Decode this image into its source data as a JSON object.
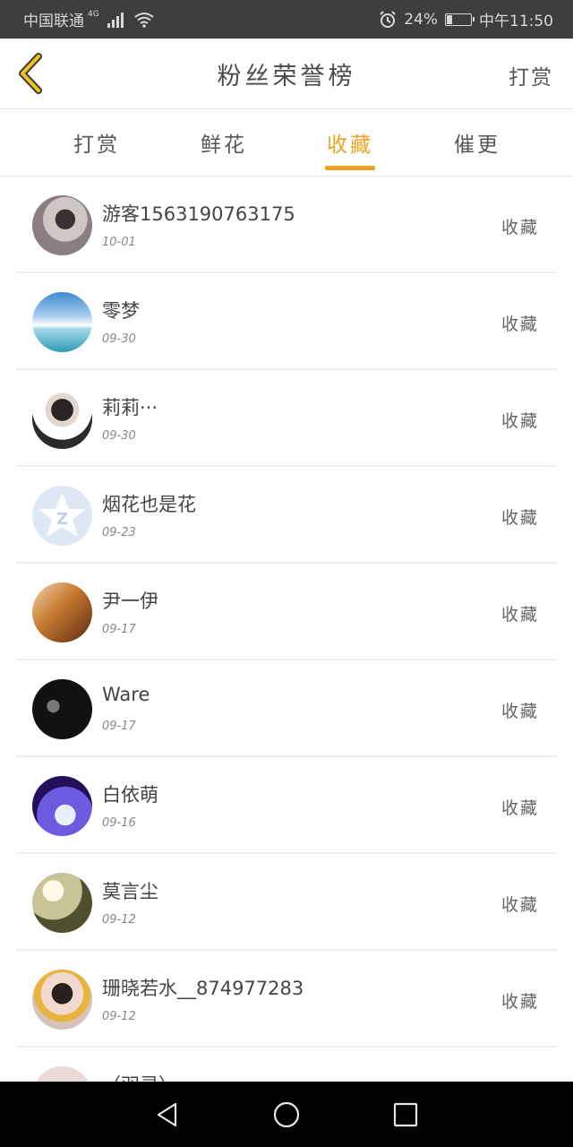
{
  "status_bar": {
    "carrier": "中国联通",
    "network": "4G",
    "battery": "24%",
    "battery_level": 0.24,
    "time": "中午11:50"
  },
  "header": {
    "title": "粉丝荣誉榜",
    "right_action": "打赏"
  },
  "tabs": [
    {
      "label": "打赏",
      "active": false
    },
    {
      "label": "鲜花",
      "active": false
    },
    {
      "label": "收藏",
      "active": true
    },
    {
      "label": "催更",
      "active": false
    }
  ],
  "list": [
    {
      "name": "游客1563190763175",
      "date": "10-01",
      "action": "收藏"
    },
    {
      "name": "零梦",
      "date": "09-30",
      "action": "收藏"
    },
    {
      "name": "莉莉···",
      "date": "09-30",
      "action": "收藏"
    },
    {
      "name": "烟花也是花",
      "date": "09-23",
      "action": "收藏"
    },
    {
      "name": "尹一伊",
      "date": "09-17",
      "action": "收藏"
    },
    {
      "name": "Ware",
      "date": "09-17",
      "action": "收藏"
    },
    {
      "name": "白依萌",
      "date": "09-16",
      "action": "收藏"
    },
    {
      "name": "莫言尘",
      "date": "09-12",
      "action": "收藏"
    },
    {
      "name": "珊晓若水__874977283",
      "date": "09-12",
      "action": "收藏"
    },
    {
      "name": "（羽灵）",
      "date": "",
      "action": ""
    }
  ],
  "colors": {
    "accent": "#f0a322",
    "status_bar_bg": "#3e3e3e",
    "nav_bar_bg": "#000000"
  }
}
